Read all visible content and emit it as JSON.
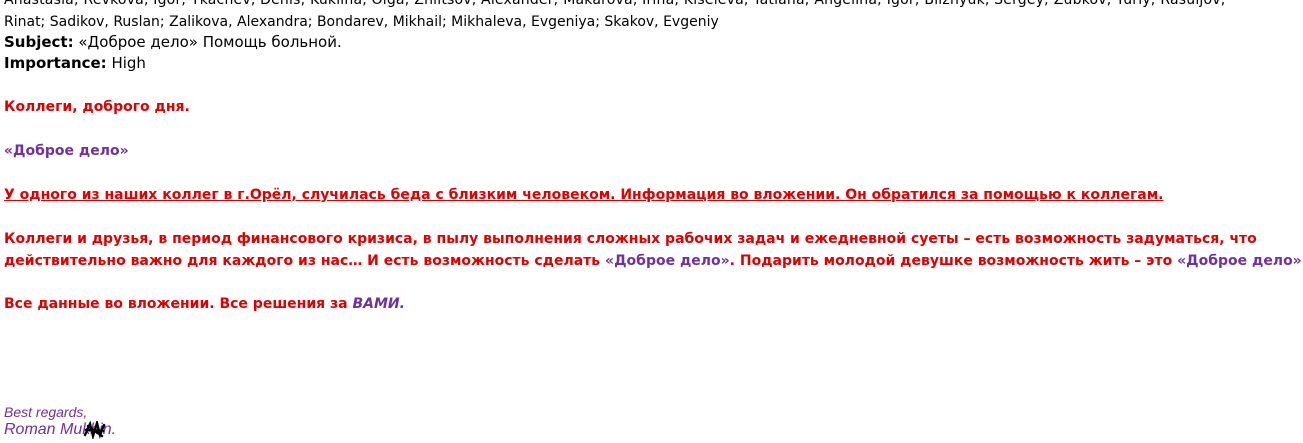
{
  "header": {
    "recipients_line_1": "Anastasia; Revkova, Igor; Tkachev, Denis; Kuklina, Olga; Zhiltsov, Alexander; Makarova, Irina; Kiseleva, Tatiana; Angelina; Igor; Bliznyuk, Sergey; Zubkov, Yuriy; Rasuljov,",
    "recipients_line_2": "Rinat; Sadikov, Ruslan; Zalikova, Alexandra; Bondarev, Mikhail; Mikhaleva, Evgeniya; Skakov, Evgeniy",
    "subject_label": "Subject:",
    "subject_value": " «Доброе дело» Помощь больной.",
    "importance_label": "Importance:",
    "importance_value": " High"
  },
  "body": {
    "greeting": "Коллеги, доброго дня.",
    "project_name": "«Доброе дело»",
    "announcement": "У одного из наших коллег в г.Орёл, случилась беда с близким человеком.  Информация во вложении. Он обратился за помощью к коллегам.",
    "appeal_line_1": "Коллеги и друзья, в период финансового кризиса,  в пылу выполнения сложных рабочих задач и ежедневной суеты – есть возможность задуматься, что",
    "appeal_line_2_part_1": "действительно важно для каждого из нас…  И есть возможность сделать ",
    "appeal_line_2_part_2": "«Доброе дело»",
    "appeal_line_2_part_3": ".  Подарить  молодой девушке возможность жить – это  ",
    "appeal_line_2_part_4": "«Доброе дело»",
    "appeal_line_2_part_5": "!",
    "closing_part_1": "Все данные во вложении. Все решения за ",
    "closing_part_2": "ВАМИ."
  },
  "signature": {
    "regards": "Best regards,",
    "name": "Roman Mukhin."
  },
  "colors": {
    "red": "#e00000",
    "purple": "#7030a0",
    "black": "#000000"
  }
}
